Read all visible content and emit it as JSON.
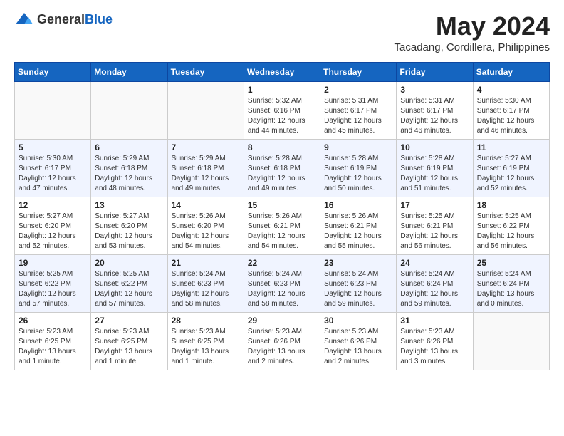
{
  "header": {
    "logo_general": "General",
    "logo_blue": "Blue",
    "title": "May 2024",
    "subtitle": "Tacadang, Cordillera, Philippines"
  },
  "days_of_week": [
    "Sunday",
    "Monday",
    "Tuesday",
    "Wednesday",
    "Thursday",
    "Friday",
    "Saturday"
  ],
  "weeks": [
    [
      {
        "day": "",
        "content": ""
      },
      {
        "day": "",
        "content": ""
      },
      {
        "day": "",
        "content": ""
      },
      {
        "day": "1",
        "content": "Sunrise: 5:32 AM\nSunset: 6:16 PM\nDaylight: 12 hours\nand 44 minutes."
      },
      {
        "day": "2",
        "content": "Sunrise: 5:31 AM\nSunset: 6:17 PM\nDaylight: 12 hours\nand 45 minutes."
      },
      {
        "day": "3",
        "content": "Sunrise: 5:31 AM\nSunset: 6:17 PM\nDaylight: 12 hours\nand 46 minutes."
      },
      {
        "day": "4",
        "content": "Sunrise: 5:30 AM\nSunset: 6:17 PM\nDaylight: 12 hours\nand 46 minutes."
      }
    ],
    [
      {
        "day": "5",
        "content": "Sunrise: 5:30 AM\nSunset: 6:17 PM\nDaylight: 12 hours\nand 47 minutes."
      },
      {
        "day": "6",
        "content": "Sunrise: 5:29 AM\nSunset: 6:18 PM\nDaylight: 12 hours\nand 48 minutes."
      },
      {
        "day": "7",
        "content": "Sunrise: 5:29 AM\nSunset: 6:18 PM\nDaylight: 12 hours\nand 49 minutes."
      },
      {
        "day": "8",
        "content": "Sunrise: 5:28 AM\nSunset: 6:18 PM\nDaylight: 12 hours\nand 49 minutes."
      },
      {
        "day": "9",
        "content": "Sunrise: 5:28 AM\nSunset: 6:19 PM\nDaylight: 12 hours\nand 50 minutes."
      },
      {
        "day": "10",
        "content": "Sunrise: 5:28 AM\nSunset: 6:19 PM\nDaylight: 12 hours\nand 51 minutes."
      },
      {
        "day": "11",
        "content": "Sunrise: 5:27 AM\nSunset: 6:19 PM\nDaylight: 12 hours\nand 52 minutes."
      }
    ],
    [
      {
        "day": "12",
        "content": "Sunrise: 5:27 AM\nSunset: 6:20 PM\nDaylight: 12 hours\nand 52 minutes."
      },
      {
        "day": "13",
        "content": "Sunrise: 5:27 AM\nSunset: 6:20 PM\nDaylight: 12 hours\nand 53 minutes."
      },
      {
        "day": "14",
        "content": "Sunrise: 5:26 AM\nSunset: 6:20 PM\nDaylight: 12 hours\nand 54 minutes."
      },
      {
        "day": "15",
        "content": "Sunrise: 5:26 AM\nSunset: 6:21 PM\nDaylight: 12 hours\nand 54 minutes."
      },
      {
        "day": "16",
        "content": "Sunrise: 5:26 AM\nSunset: 6:21 PM\nDaylight: 12 hours\nand 55 minutes."
      },
      {
        "day": "17",
        "content": "Sunrise: 5:25 AM\nSunset: 6:21 PM\nDaylight: 12 hours\nand 56 minutes."
      },
      {
        "day": "18",
        "content": "Sunrise: 5:25 AM\nSunset: 6:22 PM\nDaylight: 12 hours\nand 56 minutes."
      }
    ],
    [
      {
        "day": "19",
        "content": "Sunrise: 5:25 AM\nSunset: 6:22 PM\nDaylight: 12 hours\nand 57 minutes."
      },
      {
        "day": "20",
        "content": "Sunrise: 5:25 AM\nSunset: 6:22 PM\nDaylight: 12 hours\nand 57 minutes."
      },
      {
        "day": "21",
        "content": "Sunrise: 5:24 AM\nSunset: 6:23 PM\nDaylight: 12 hours\nand 58 minutes."
      },
      {
        "day": "22",
        "content": "Sunrise: 5:24 AM\nSunset: 6:23 PM\nDaylight: 12 hours\nand 58 minutes."
      },
      {
        "day": "23",
        "content": "Sunrise: 5:24 AM\nSunset: 6:23 PM\nDaylight: 12 hours\nand 59 minutes."
      },
      {
        "day": "24",
        "content": "Sunrise: 5:24 AM\nSunset: 6:24 PM\nDaylight: 12 hours\nand 59 minutes."
      },
      {
        "day": "25",
        "content": "Sunrise: 5:24 AM\nSunset: 6:24 PM\nDaylight: 13 hours\nand 0 minutes."
      }
    ],
    [
      {
        "day": "26",
        "content": "Sunrise: 5:23 AM\nSunset: 6:25 PM\nDaylight: 13 hours\nand 1 minute."
      },
      {
        "day": "27",
        "content": "Sunrise: 5:23 AM\nSunset: 6:25 PM\nDaylight: 13 hours\nand 1 minute."
      },
      {
        "day": "28",
        "content": "Sunrise: 5:23 AM\nSunset: 6:25 PM\nDaylight: 13 hours\nand 1 minute."
      },
      {
        "day": "29",
        "content": "Sunrise: 5:23 AM\nSunset: 6:26 PM\nDaylight: 13 hours\nand 2 minutes."
      },
      {
        "day": "30",
        "content": "Sunrise: 5:23 AM\nSunset: 6:26 PM\nDaylight: 13 hours\nand 2 minutes."
      },
      {
        "day": "31",
        "content": "Sunrise: 5:23 AM\nSunset: 6:26 PM\nDaylight: 13 hours\nand 3 minutes."
      },
      {
        "day": "",
        "content": ""
      }
    ]
  ]
}
